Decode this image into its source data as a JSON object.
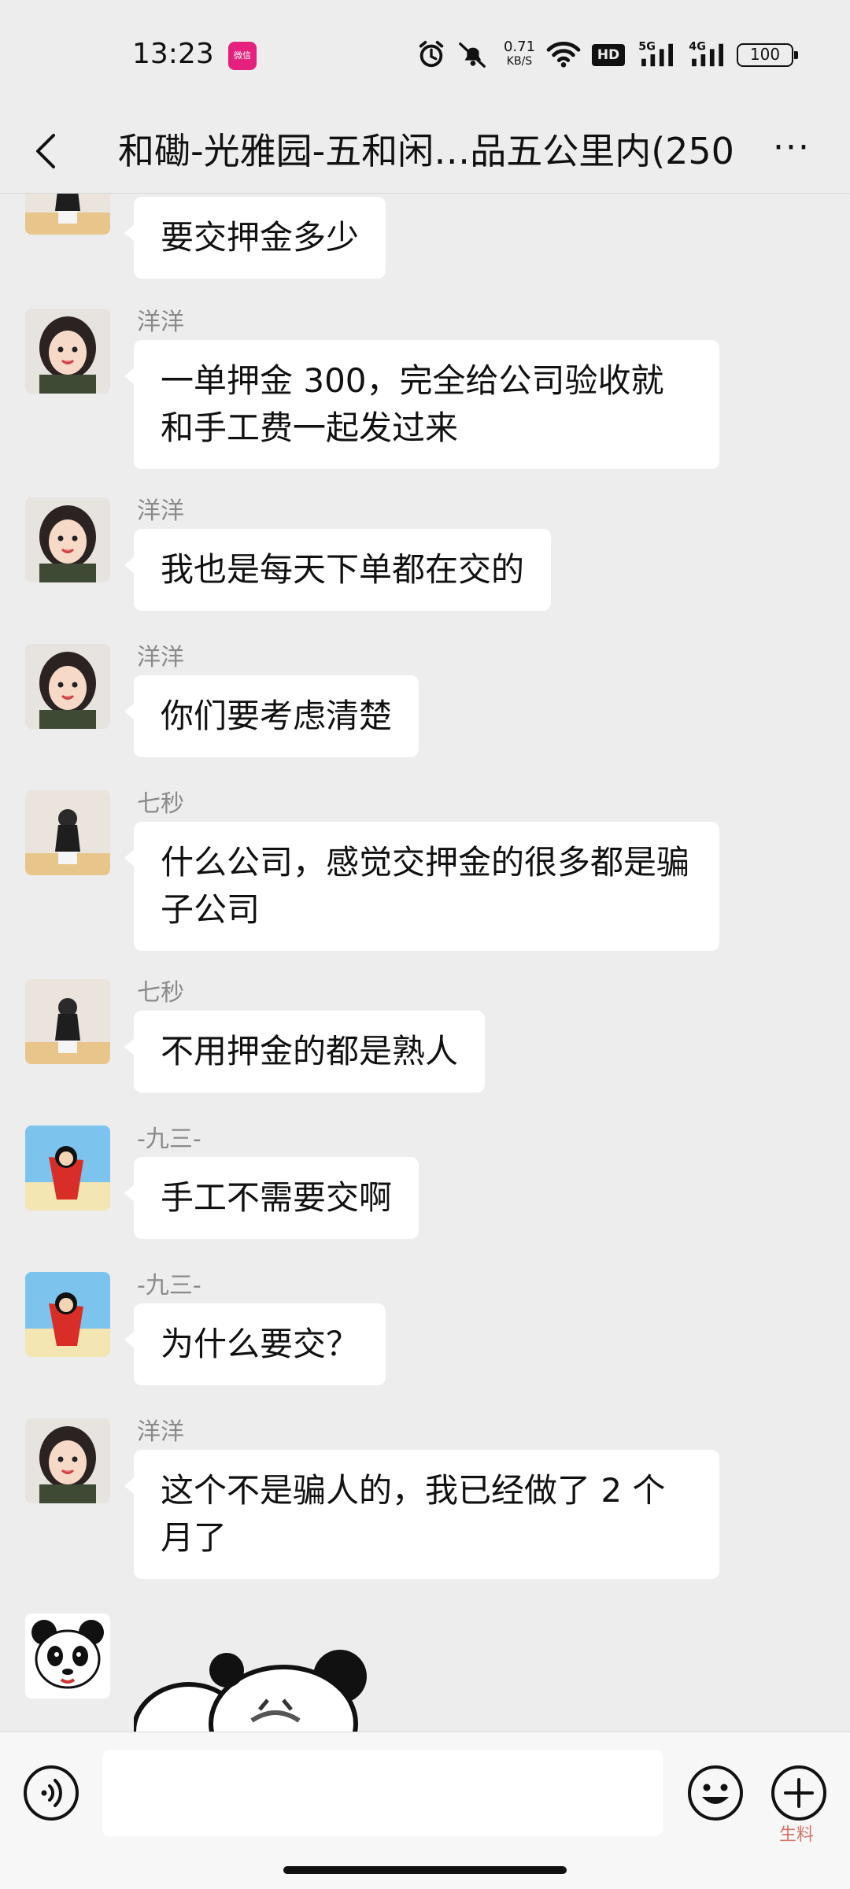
{
  "status": {
    "time": "13:23",
    "app_badge": "微信",
    "speed_value": "0.71",
    "speed_unit": "KB/S",
    "hd": "HD",
    "net1": "5G",
    "net2": "4G",
    "battery": "100"
  },
  "header": {
    "title": "和磡-光雅园-五和闲…品五公里内(250)",
    "more": "···"
  },
  "messages": [
    {
      "sender": "",
      "text": "要交押金多少",
      "avatar": "girl-back-avatar"
    },
    {
      "sender": "洋洋",
      "text": "一单押金 300，完全给公司验收就和手工费一起发过来",
      "avatar": "girl-face-avatar"
    },
    {
      "sender": "洋洋",
      "text": "我也是每天下单都在交的",
      "avatar": "girl-face-avatar"
    },
    {
      "sender": "洋洋",
      "text": "你们要考虑清楚",
      "avatar": "girl-face-avatar"
    },
    {
      "sender": "七秒",
      "text": "什么公司，感觉交押金的很多都是骗子公司",
      "avatar": "girl-back-avatar"
    },
    {
      "sender": "七秒",
      "text": "不用押金的都是熟人",
      "avatar": "girl-back-avatar"
    },
    {
      "sender": "-九三-",
      "text": "手工不需要交啊",
      "avatar": "cartoon-avatar"
    },
    {
      "sender": "-九三-",
      "text": "为什么要交？",
      "avatar": "cartoon-avatar"
    },
    {
      "sender": "洋洋",
      "text": "这个不是骗人的，我已经做了 2 个月了",
      "avatar": "girl-face-avatar"
    },
    {
      "sender": "",
      "text": "",
      "avatar": "panda-avatar"
    }
  ],
  "input": {
    "placeholder": ""
  },
  "watermark": "生料"
}
